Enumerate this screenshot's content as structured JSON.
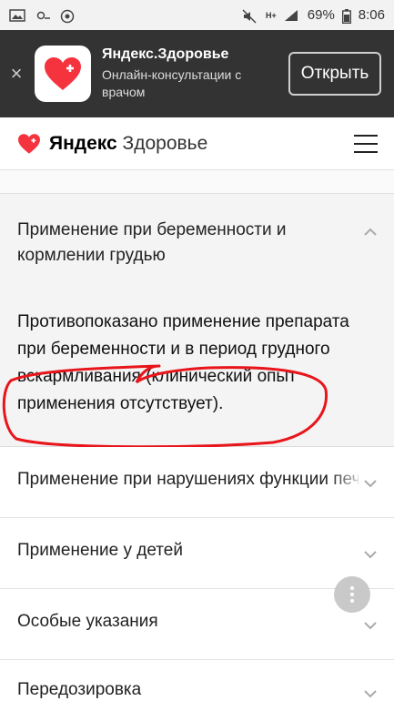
{
  "status_bar": {
    "battery": "69%",
    "time": "8:06",
    "network": "H+"
  },
  "banner": {
    "app_name": "Яндекс.Здоровье",
    "subtitle": "Онлайн-консультации с врачом",
    "open_label": "Открыть",
    "close_glyph": "×"
  },
  "header": {
    "brand_ya": "Яндекс",
    "brand_rest": "Здоровье"
  },
  "sections": {
    "open": {
      "title": "Применение при беременности и кормлении грудью",
      "body": "Противопоказано применение препарата при беременности и в период грудного вскармливания (клинический опыт применения отсутствует)."
    },
    "rows": [
      {
        "label": "Применение при нарушениях функции печени"
      },
      {
        "label": "Применение у детей"
      },
      {
        "label": "Особые указания"
      },
      {
        "label": "Передозировка"
      }
    ]
  },
  "colors": {
    "brand_red": "#f5333f",
    "annotation_red": "#e8151b",
    "banner_bg": "#333333"
  },
  "icons": {
    "menu": "hamburger-icon",
    "expand": "chevron-down-icon",
    "collapse": "chevron-up-icon",
    "more": "more-vertical-icon"
  }
}
